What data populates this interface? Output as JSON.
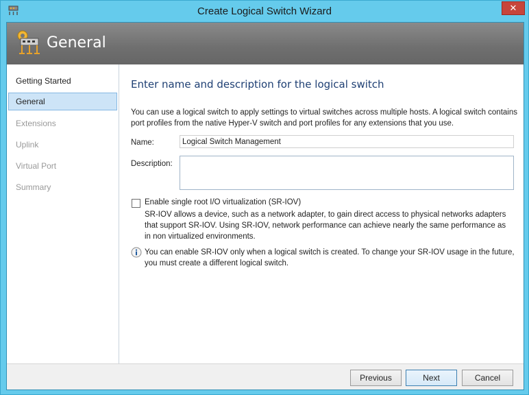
{
  "window": {
    "title": "Create Logical Switch Wizard",
    "close_label": "✕"
  },
  "banner": {
    "title": "General"
  },
  "sidebar": {
    "items": [
      {
        "label": "Getting Started"
      },
      {
        "label": "General"
      },
      {
        "label": "Extensions"
      },
      {
        "label": "Uplink"
      },
      {
        "label": "Virtual Port"
      },
      {
        "label": "Summary"
      }
    ]
  },
  "main": {
    "heading": "Enter name and description for the logical switch",
    "intro": "You can use a logical switch to apply settings to virtual switches across multiple hosts. A logical switch contains port profiles from the native Hyper-V switch and port profiles for any extensions that you use.",
    "name_label": "Name:",
    "name_value": "Logical Switch Management",
    "description_label": "Description:",
    "description_value": "",
    "sriov_label": "Enable single root I/O virtualization (SR-IOV)",
    "sriov_checked": false,
    "sriov_description": "SR-IOV allows a device, such as a network adapter, to gain direct access to physical networks adapters that support SR-IOV. Using SR-IOV, network performance can achieve nearly the same performance as in non virtualized environments.",
    "info_text": "You can enable SR-IOV only when a logical switch is created. To change your SR-IOV usage in the future, you must create a different logical switch."
  },
  "footer": {
    "previous_label": "Previous",
    "next_label": "Next",
    "cancel_label": "Cancel"
  },
  "icons": {
    "app": "switch-icon",
    "banner": "switch-gear-icon",
    "info": "info-icon",
    "close": "close-icon"
  },
  "colors": {
    "frame": "#65cbec",
    "banner": "#777777",
    "heading": "#1e3f73",
    "active_nav": "#cde4f7",
    "close": "#c7453b"
  }
}
